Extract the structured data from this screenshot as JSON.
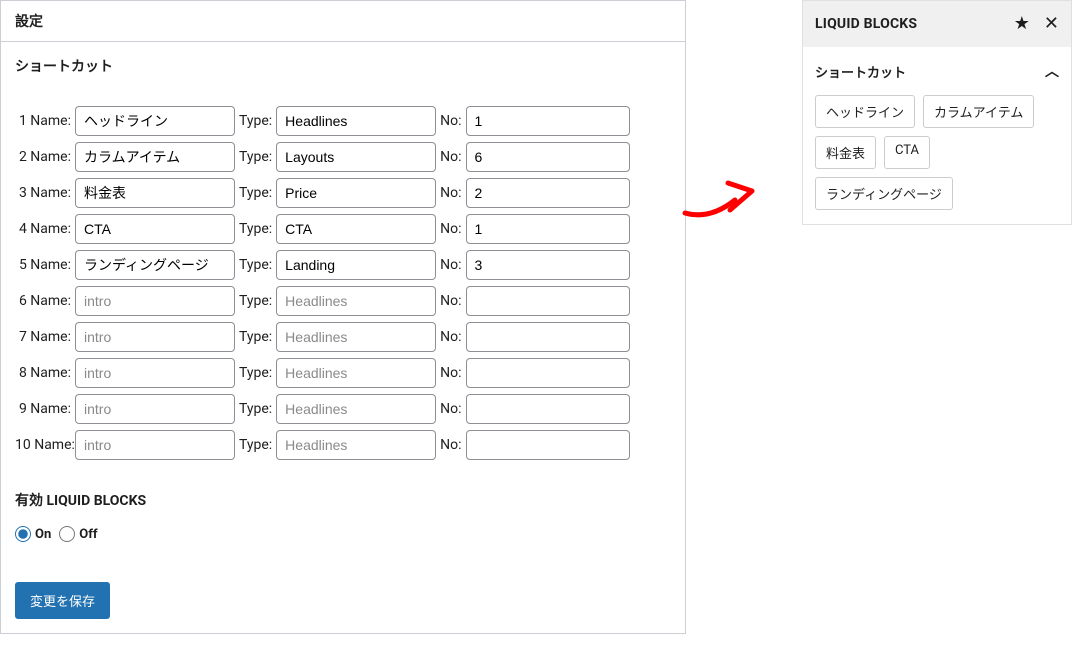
{
  "main": {
    "header": "設定",
    "shortcut_title": "ショートカット",
    "rows": [
      {
        "idx": "1",
        "name": "ヘッドライン",
        "type": "Headlines",
        "no": "1"
      },
      {
        "idx": "2",
        "name": "カラムアイテム",
        "type": "Layouts",
        "no": "6"
      },
      {
        "idx": "3",
        "name": "料金表",
        "type": "Price",
        "no": "2"
      },
      {
        "idx": "4",
        "name": "CTA",
        "type": "CTA",
        "no": "1"
      },
      {
        "idx": "5",
        "name": "ランディングページ",
        "type": "Landing",
        "no": "3"
      },
      {
        "idx": "6",
        "name": "",
        "type": "",
        "no": ""
      },
      {
        "idx": "7",
        "name": "",
        "type": "",
        "no": ""
      },
      {
        "idx": "8",
        "name": "",
        "type": "",
        "no": ""
      },
      {
        "idx": "9",
        "name": "",
        "type": "",
        "no": ""
      },
      {
        "idx": "10",
        "name": "",
        "type": "",
        "no": ""
      }
    ],
    "placeholders": {
      "name": "intro",
      "type": "Headlines"
    },
    "labels": {
      "name": "Name:",
      "type": "Type:",
      "no": "No:"
    },
    "enabled_title": "有効 LIQUID BLOCKS",
    "radio_on": "On",
    "radio_off": "Off",
    "save": "変更を保存"
  },
  "sidebar": {
    "title": "LIQUID BLOCKS",
    "section_title": "ショートカット",
    "tags": [
      "ヘッドライン",
      "カラムアイテム",
      "料金表",
      "CTA",
      "ランディングページ"
    ]
  }
}
